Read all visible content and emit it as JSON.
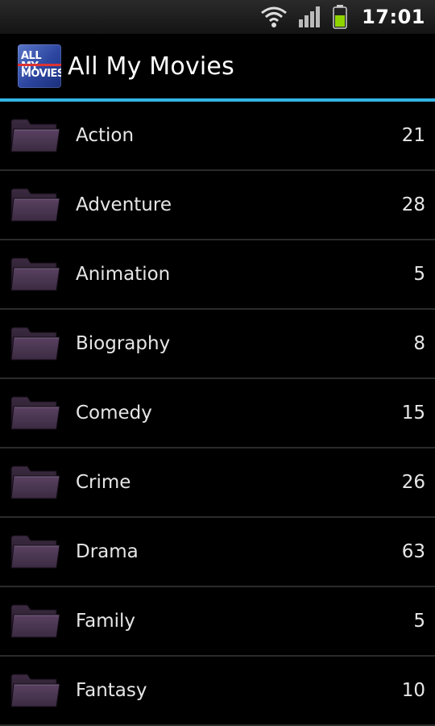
{
  "status_bar": {
    "time": "17:01",
    "icons": [
      "wifi-icon",
      "signal-icon",
      "battery-icon"
    ],
    "battery_color": "#8fd400"
  },
  "app": {
    "title": "All My Movies",
    "logo_text_line1": "ALL MY",
    "logo_text_line2": "MOVIES",
    "accent_color": "#33b5e5"
  },
  "categories": [
    {
      "label": "Action",
      "count": "21"
    },
    {
      "label": "Adventure",
      "count": "28"
    },
    {
      "label": "Animation",
      "count": "5"
    },
    {
      "label": "Biography",
      "count": "8"
    },
    {
      "label": "Comedy",
      "count": "15"
    },
    {
      "label": "Crime",
      "count": "26"
    },
    {
      "label": "Drama",
      "count": "63"
    },
    {
      "label": "Family",
      "count": "5"
    },
    {
      "label": "Fantasy",
      "count": "10"
    }
  ]
}
